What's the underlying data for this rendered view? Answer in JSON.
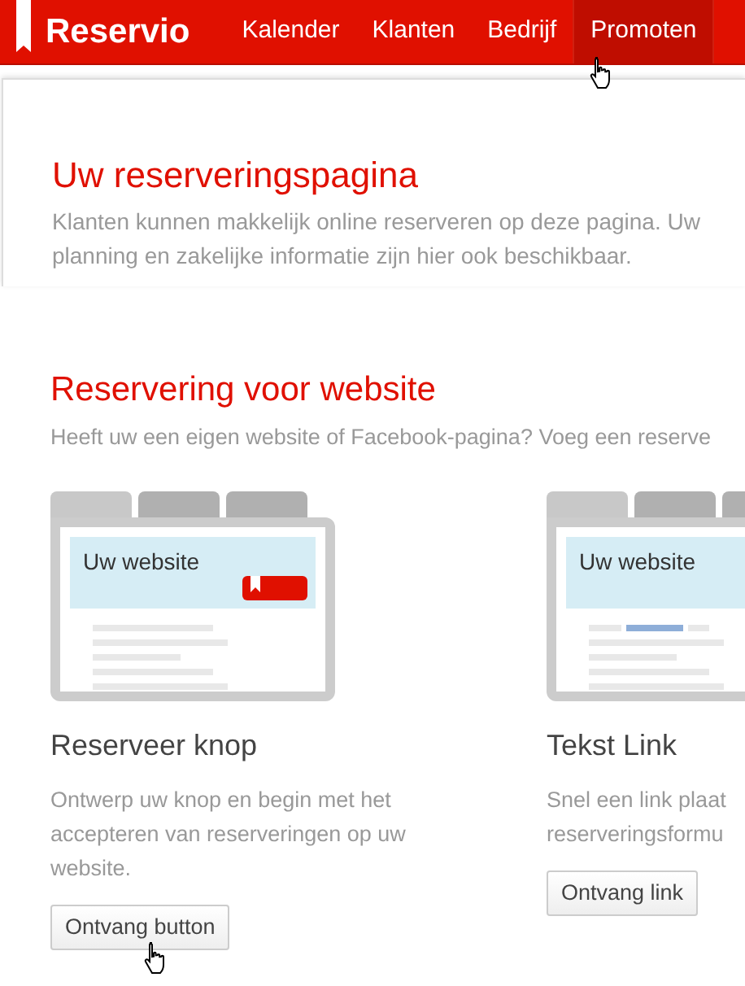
{
  "brand": "Reservio",
  "nav": [
    {
      "label": "Kalender",
      "selected": false
    },
    {
      "label": "Klanten",
      "selected": false
    },
    {
      "label": "Bedrijf",
      "selected": false
    },
    {
      "label": "Promoten",
      "selected": true
    }
  ],
  "intro": {
    "title": "Uw reserveringspagina",
    "text": "Klanten kunnen makkelijk online reserveren op deze pagina. Uw planning en zakelijke informatie zijn hier ook beschikbaar."
  },
  "section": {
    "title": "Reservering voor website",
    "text": "Heeft uw een eigen website of Facebook-pagina? Voeg een reserve"
  },
  "cards": [
    {
      "kind": "button",
      "preview_label": "Uw website",
      "title": "Reserveer knop",
      "lines": [
        "Ontwerp uw knop en begin met het",
        "accepteren van reserveringen op uw",
        "website."
      ],
      "action": "Ontvang button"
    },
    {
      "kind": "link",
      "preview_label": "Uw website",
      "title": "Tekst Link",
      "lines": [
        "Snel een link plaat",
        "reserveringsformu"
      ],
      "action": "Ontvang link"
    }
  ]
}
